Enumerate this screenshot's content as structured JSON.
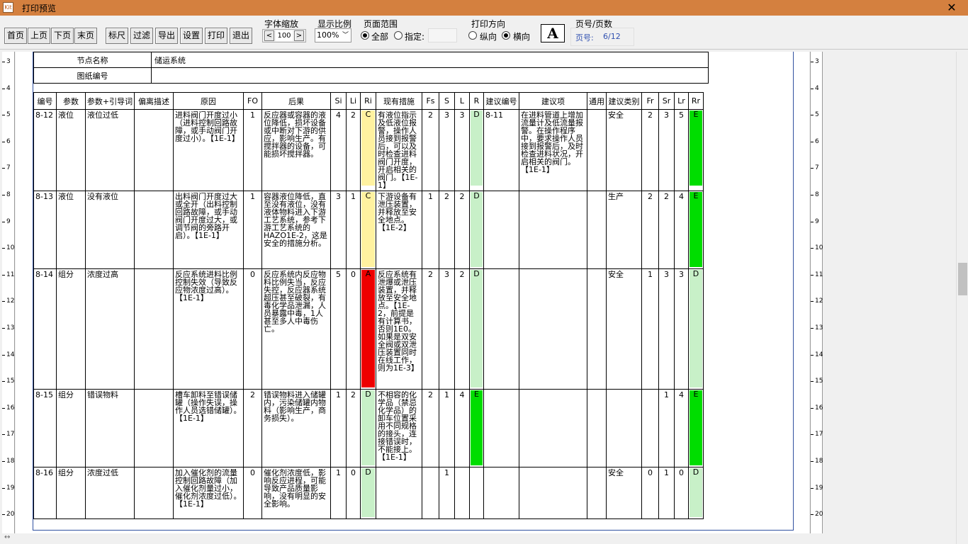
{
  "window": {
    "title": "打印预览",
    "icon": "app-icon",
    "close": "✕"
  },
  "toolbar": {
    "buttons": [
      "首页",
      "上页",
      "下页",
      "末页",
      "标尺",
      "过滤",
      "导出",
      "设置",
      "打印",
      "退出"
    ],
    "font_scale": {
      "label": "字体缩放",
      "value": "100",
      "dec": "<",
      "inc": ">"
    },
    "zoom": {
      "label": "显示比例",
      "value": "100%"
    },
    "range": {
      "label": "页面范围",
      "all": "全部",
      "specify": "指定:",
      "selected": "all"
    },
    "orientation": {
      "label": "打印方向",
      "portrait": "纵向",
      "landscape": "横向",
      "selected": "landscape"
    },
    "font_icon": "A",
    "pagenum": {
      "label": "页号/页数",
      "prefix": "页号:",
      "value": "6/12"
    }
  },
  "header_table": {
    "node_label": "节点名称",
    "node_value": "储运系统",
    "drawing_label": "图纸编号",
    "drawing_value": ""
  },
  "columns": [
    "编号",
    "参数",
    "参数+引导词",
    "偏离描述",
    "原因",
    "FO",
    "后果",
    "Si",
    "Li",
    "Ri",
    "现有措施",
    "Fs",
    "S",
    "L",
    "R",
    "建议编号",
    "建议项",
    "通用",
    "建议类别",
    "Fr",
    "Sr",
    "Lr",
    "Rr"
  ],
  "colors": {
    "green": "#00dd00",
    "lightgreen": "#c8f0c8",
    "yellow": "#fff2a0",
    "red": "#ee0000"
  },
  "rows": [
    {
      "id": "8-12",
      "param": "液位",
      "guide": "液位过低",
      "dev": "",
      "cause": "进料阀门开度过小（进料控制回路故障，或手动阀门开度过小）。【1E-1】",
      "fo": "1",
      "conseq": "反应器或容器的液位降低，损坏设备或中断对下游的供应，影响生产。有搅拌器的设备，可能损坏搅拌器。",
      "si": "4",
      "li": "2",
      "ri": "C",
      "measures": "有液位指示及低液位报警，操作人员接到报警后，可以及时检查进料阀门开度，开启相关的阀门。【1E-1】",
      "fs": "2",
      "s": "3",
      "l": "3",
      "r": "D",
      "sug_id": "8-11",
      "sug": "在进料管道上增加流量计及低流量报警。在操作程序中，要求操作人员接到报警后，及时检查进料状况，开启相关的阀门。【1E-1】",
      "gen": "",
      "cat": "安全",
      "fr": "2",
      "sr": "3",
      "lr": "5",
      "rr": "E"
    },
    {
      "id": "8-13",
      "param": "液位",
      "guide": "没有液位",
      "dev": "",
      "cause": "出料阀门开度过大或全开（出料控制回路故障，或手动阀门开度过大，或调节阀的旁路开启）。【1E-1】",
      "fo": "1",
      "conseq": "容器液位降低，直至没有液位，没有液体物料进入下游工艺系统，参考下游工艺系统的HAZO1E-2，这是安全的措施分析。",
      "si": "3",
      "li": "1",
      "ri": "C",
      "measures": "下游设备有泄压装置，并释放至安全地点。【1E-2】",
      "fs": "1",
      "s": "2",
      "l": "2",
      "r": "D",
      "sug_id": "",
      "sug": "",
      "gen": "",
      "cat": "生产",
      "fr": "2",
      "sr": "2",
      "lr": "4",
      "rr": "E"
    },
    {
      "id": "8-14",
      "param": "组分",
      "guide": "浓度过高",
      "dev": "",
      "cause": "反应系统进料比例控制失效（导致反应物浓度过高）。【1E-1】",
      "fo": "0",
      "conseq": "反应系统内反应物料比例失当，反应失控，反应器系统超压甚至破裂，有毒化学品泄漏，人员暴露中毒，1人甚至多人中毒伤亡。",
      "si": "5",
      "li": "0",
      "ri": "A",
      "measures": "反应系统有泄爆或泄压装置，并释放至安全地点。【1E-2，前提是有计算书，否则1E0。如果是双安全阀或双泄压装置同时在线工作，则为1E-3】",
      "fs": "2",
      "s": "3",
      "l": "2",
      "r": "D",
      "sug_id": "",
      "sug": "",
      "gen": "",
      "cat": "安全",
      "fr": "1",
      "sr": "3",
      "lr": "3",
      "rr": "D"
    },
    {
      "id": "8-15",
      "param": "组分",
      "guide": "错误物料",
      "dev": "",
      "cause": "槽车卸料至错误储罐（操作失误，操作人员选错储罐）。【1E-1】",
      "fo": "2",
      "conseq": "错误物料进入储罐内，污染储罐内物料（影响生产，商务损失）。",
      "si": "1",
      "li": "2",
      "ri": "D",
      "measures": "不相容的化学品（禁忌化学品）的卸车位置采用不同规格的接头，连接错误时，不能接上。【1E-1】",
      "fs": "2",
      "s": "1",
      "l": "4",
      "r": "E",
      "sug_id": "",
      "sug": "",
      "gen": "",
      "cat": "",
      "fr": "",
      "sr": "1",
      "lr": "4",
      "rr": "E"
    },
    {
      "id": "8-16",
      "param": "组分",
      "guide": "浓度过低",
      "dev": "",
      "cause": "加入催化剂的流量控制回路故障（加入催化剂量过小，催化剂浓度过低）。【1E-1】",
      "fo": "0",
      "conseq": "催化剂浓度低，影响反应进程，可能导致产品质量影响，没有明显的安全影响。",
      "si": "1",
      "li": "0",
      "ri": "D",
      "measures": "",
      "fs": "",
      "s": "1",
      "l": "",
      "r": "",
      "sug_id": "",
      "sug": "",
      "gen": "",
      "cat": "安全",
      "fr": "0",
      "sr": "1",
      "lr": "0",
      "rr": "D"
    }
  ],
  "ruler_left": [
    "3",
    "4",
    "5",
    "6",
    "7",
    "8",
    "9",
    "10",
    "11",
    "12",
    "13",
    "14",
    "15",
    "16",
    "17",
    "18",
    "19",
    "20"
  ],
  "ruler_right": [
    "3",
    "4",
    "5",
    "6",
    "7",
    "8",
    "9",
    "10",
    "11",
    "12",
    "13",
    "14",
    "15",
    "16",
    "17",
    "18",
    "19",
    "20"
  ]
}
